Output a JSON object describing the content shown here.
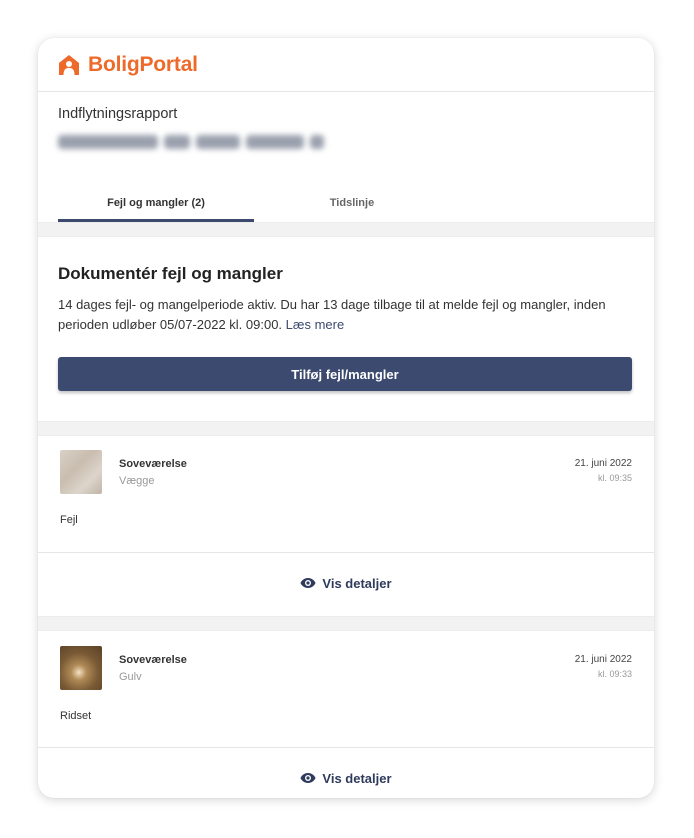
{
  "brand": {
    "name": "BoligPortal",
    "color": "#ee6a2b",
    "icon": "house-person-icon"
  },
  "report": {
    "title": "Indflytningsrapport"
  },
  "tabs": [
    {
      "label": "Fejl og mangler (2)",
      "active": true
    },
    {
      "label": "Tidslinje",
      "active": false
    }
  ],
  "documentation": {
    "title": "Dokumentér fejl og mangler",
    "text": "14 dages fejl- og mangelperiode aktiv. Du har 13 dage tilbage til at melde fejl og mangler, inden perioden udløber 05/07-2022 kl. 09:00.",
    "link": "Læs mere",
    "button": "Tilføj fejl/mangler"
  },
  "items": [
    {
      "room": "Soveværelse",
      "category": "Vægge",
      "date": "21. juni 2022",
      "time": "kl. 09:35",
      "description": "Fejl",
      "details_label": "Vis detaljer"
    },
    {
      "room": "Soveværelse",
      "category": "Gulv",
      "date": "21. juni 2022",
      "time": "kl. 09:33",
      "description": "Ridset",
      "details_label": "Vis detaljer"
    }
  ],
  "colors": {
    "primary": "#3c4a6f",
    "accent": "#ee6a2b"
  }
}
